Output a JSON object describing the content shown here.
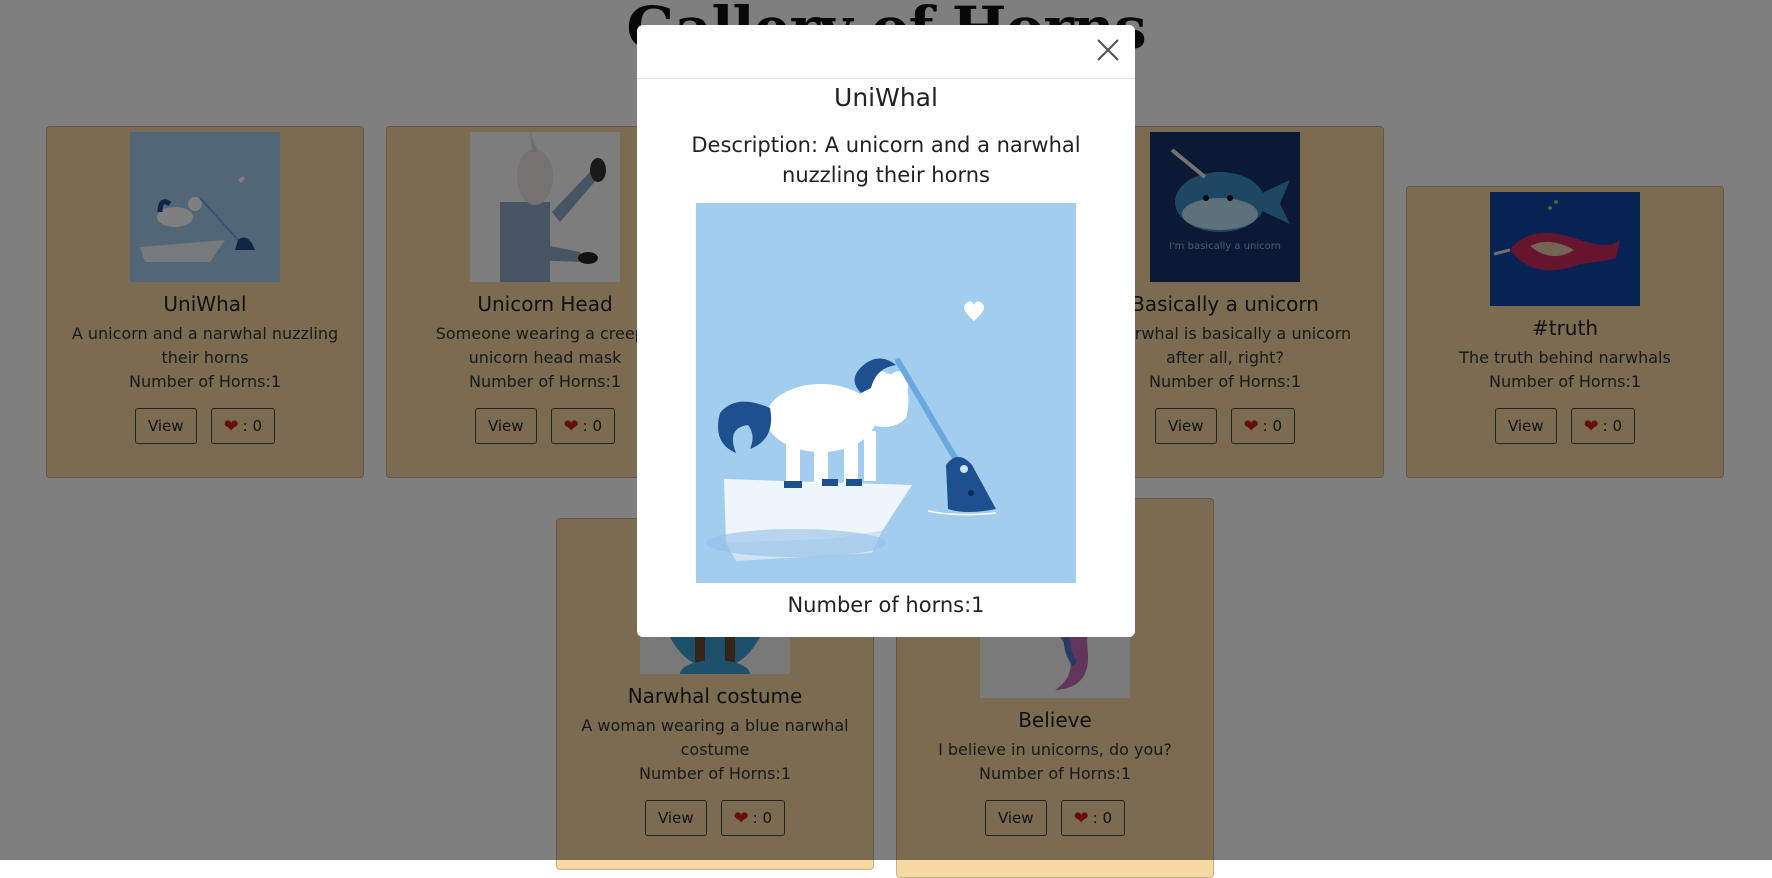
{
  "page": {
    "title": "Gallery of Horns"
  },
  "gallery": {
    "view_label": "View",
    "cards": [
      {
        "title": "UniWhal",
        "description": "A unicorn and a narwhal nuzzling their horns",
        "horns": "Number of Horns:1",
        "likes": ": 0"
      },
      {
        "title": "Unicorn Head",
        "description": "Someone wearing a creepy unicorn head mask",
        "horns": "Number of Horns:1",
        "likes": ": 0"
      },
      {
        "title": "Basically a unicorn",
        "description": "A narwhal is basically a unicorn after all, right?",
        "horns": "Number of Horns:1",
        "likes": ": 0"
      },
      {
        "title": "#truth",
        "description": "The truth behind narwhals",
        "horns": "Number of Horns:1",
        "likes": ": 0"
      },
      {
        "title": "Narwhal costume",
        "description": "A woman wearing a blue narwhal costume",
        "horns": "Number of Horns:1",
        "likes": ": 0"
      },
      {
        "title": "Believe",
        "description": "I believe in unicorns, do you?",
        "horns": "Number of Horns:1",
        "likes": ": 0"
      }
    ]
  },
  "modal": {
    "title": "UniWhal",
    "description": "Description: A unicorn and a narwhal nuzzling their horns",
    "horns": "Number of horns:1",
    "close_icon": "close-icon"
  },
  "colors": {
    "card_bg": "#f6d8a3",
    "overlay": "rgba(0,0,0,0.5)",
    "heart": "#d11c1c",
    "image_bg": "#a3cdee"
  }
}
